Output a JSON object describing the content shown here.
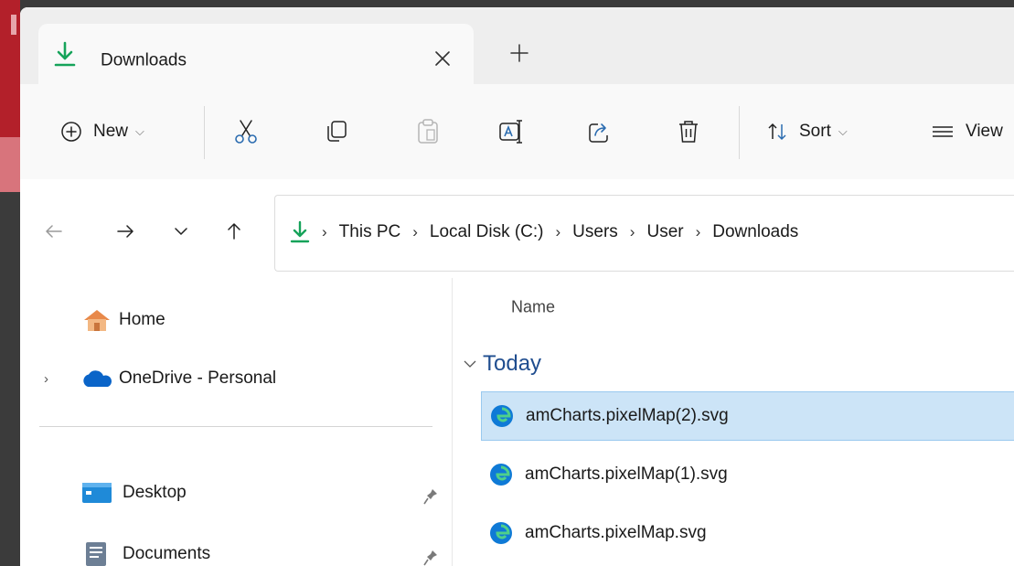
{
  "tab": {
    "title": "Downloads"
  },
  "toolbar": {
    "new_label": "New",
    "sort_label": "Sort",
    "view_label": "View"
  },
  "breadcrumb": [
    "This PC",
    "Local Disk (C:)",
    "Users",
    "User",
    "Downloads"
  ],
  "sidebar": {
    "home": "Home",
    "onedrive": "OneDrive - Personal",
    "desktop": "Desktop",
    "documents": "Documents"
  },
  "content": {
    "column_name": "Name",
    "group": "Today",
    "files": [
      {
        "name": "amCharts.pixelMap(2).svg",
        "selected": true
      },
      {
        "name": "amCharts.pixelMap(1).svg",
        "selected": false
      },
      {
        "name": "amCharts.pixelMap.svg",
        "selected": false
      }
    ]
  },
  "colors": {
    "accent": "#0078d4",
    "download_icon": "#16a35a",
    "selection_bg": "#cce4f7",
    "group_title": "#1f4d8f"
  }
}
